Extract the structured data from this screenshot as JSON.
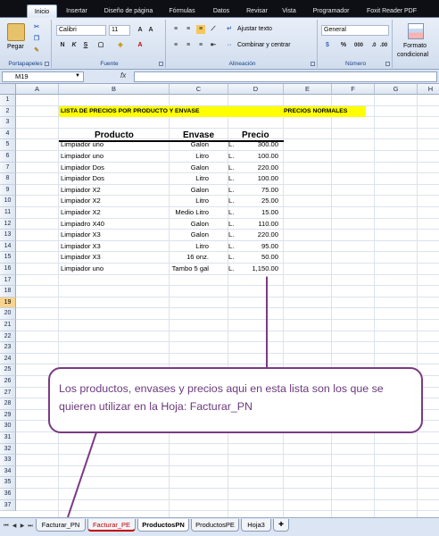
{
  "ribbon_tabs": [
    {
      "label": "Inicio",
      "active": true
    },
    {
      "label": "Insertar",
      "active": false
    },
    {
      "label": "Diseño de página",
      "active": false
    },
    {
      "label": "Fórmulas",
      "active": false
    },
    {
      "label": "Datos",
      "active": false
    },
    {
      "label": "Revisar",
      "active": false
    },
    {
      "label": "Vista",
      "active": false
    },
    {
      "label": "Programador",
      "active": false
    },
    {
      "label": "Foxit Reader PDF",
      "active": false
    }
  ],
  "ribbon": {
    "clipboard": {
      "label": "Portapapeles",
      "paste_label": "Pegar"
    },
    "font": {
      "label": "Fuente",
      "font_name": "Calibri",
      "font_size": "11",
      "bold": "N",
      "italic": "K",
      "underline": "S"
    },
    "alignment": {
      "label": "Alineación",
      "wrap_text": "Ajustar texto",
      "merge_center": "Combinar y centrar"
    },
    "number": {
      "label": "Número",
      "format": "General",
      "percent": "%",
      "thousands": "000"
    },
    "styles": {
      "conditional_format": "Formato",
      "conditional_format_2": "condicional"
    }
  },
  "formula_bar": {
    "name_box": "M19",
    "fx": "fx",
    "formula": ""
  },
  "columns": [
    "A",
    "B",
    "C",
    "D",
    "E",
    "F",
    "G",
    "H"
  ],
  "rows": [
    "1",
    "2",
    "3",
    "4",
    "5",
    "6",
    "7",
    "8",
    "9",
    "10",
    "11",
    "12",
    "13",
    "14",
    "15",
    "16",
    "17",
    "18",
    "19",
    "20",
    "21",
    "22",
    "23",
    "24",
    "25",
    "26",
    "27",
    "28",
    "29",
    "30",
    "31",
    "32",
    "33",
    "34",
    "35",
    "36",
    "37"
  ],
  "selected_row": "19",
  "sheet": {
    "title": "LISTA DE PRECIOS POR PRODUCTO Y ENVASE",
    "subtitle": "PRECIOS NORMALES",
    "headers": {
      "producto": "Producto",
      "envase": "Envase",
      "precio": "Precio"
    },
    "currency": "L.",
    "items": [
      {
        "producto": "Limpiador uno",
        "envase": "Galon",
        "precio": "300.00"
      },
      {
        "producto": "Limpiador uno",
        "envase": "Litro",
        "precio": "100.00"
      },
      {
        "producto": "Limpiador Dos",
        "envase": "Galon",
        "precio": "220.00"
      },
      {
        "producto": "Limpiador Dos",
        "envase": "Litro",
        "precio": "100.00"
      },
      {
        "producto": "Limpiador X2",
        "envase": "Galon",
        "precio": "75.00"
      },
      {
        "producto": "Limpiador X2",
        "envase": "Litro",
        "precio": "25.00"
      },
      {
        "producto": "Limpiador X2",
        "envase": "Medio Litro",
        "precio": "15.00"
      },
      {
        "producto": "Limpiadro X40",
        "envase": "Galon",
        "precio": "110.00"
      },
      {
        "producto": "Limpiador X3",
        "envase": "Galon",
        "precio": "220.00"
      },
      {
        "producto": "Limpiador X3",
        "envase": "Litro",
        "precio": "95.00"
      },
      {
        "producto": "Limpiador X3",
        "envase": "16 onz.",
        "precio": "50.00"
      },
      {
        "producto": "Limpiador uno",
        "envase": "Tambo 5 gal",
        "precio": "1,150.00"
      }
    ]
  },
  "callout": {
    "text": "Los productos, envases y precios aqui en esta lista son los que se quieren utilizar en la Hoja: Facturar_PN"
  },
  "sheet_tabs": [
    {
      "label": "Facturar_PN",
      "active": false,
      "color": "#000000"
    },
    {
      "label": "Facturar_PE",
      "active": false,
      "color": "#c00000"
    },
    {
      "label": "ProductosPN",
      "active": true,
      "color": "#000000"
    },
    {
      "label": "ProductosPE",
      "active": false,
      "color": "#000000"
    },
    {
      "label": "Hoja3",
      "active": false,
      "color": "#000000"
    }
  ],
  "colors": {
    "highlight": "#ffff00",
    "callout": "#7b3a83"
  }
}
